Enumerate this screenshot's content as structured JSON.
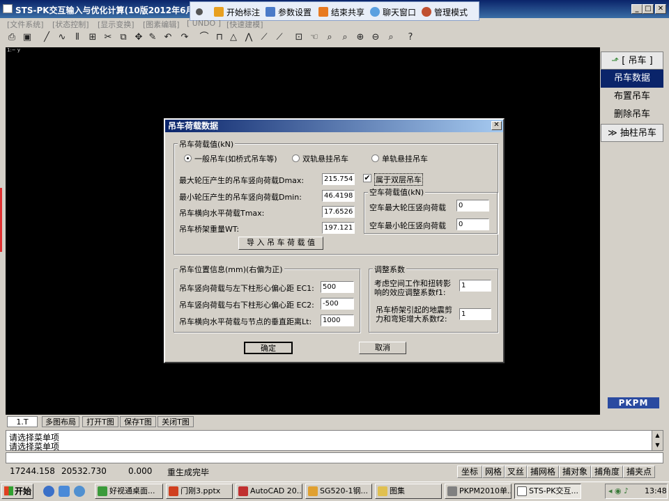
{
  "window": {
    "title": "STS-PK交互输入与优化计算(10版2012年6月30",
    "minimize": "_",
    "maximize": "□",
    "close": "✕"
  },
  "float_toolbar": {
    "items": [
      "开始标注",
      "参数设置",
      "结束共享",
      "聊天窗口",
      "管理模式"
    ]
  },
  "menu": {
    "items": [
      "[文件系统]",
      "[状态控制]",
      "[显示变换]",
      "[图素编辑]",
      "[ UNDO ]",
      "[快速建模]"
    ]
  },
  "canvas": {
    "coord_label": "1:− y"
  },
  "right_panel": {
    "header": "[ 吊车 ]",
    "items": [
      "吊车数据",
      "布置吊车",
      "删除吊车"
    ],
    "footer": "抽柱吊车",
    "logo": "PKPM"
  },
  "dialog": {
    "title": "吊车荷载数据",
    "close": "✕",
    "load_group": {
      "label": "吊车荷载值(kN)",
      "radios": [
        "一般吊车(如桥式吊车等)",
        "双轨悬挂吊车",
        "单轨悬挂吊车"
      ],
      "selected_radio": 0,
      "fields": [
        {
          "label": "最大轮压产生的吊车竖向荷载Dmax:",
          "value": "215.754"
        },
        {
          "label": "最小轮压产生的吊车竖向荷载Dmin:",
          "value": "46.4198"
        },
        {
          "label": "吊车横向水平荷载Tmax:",
          "value": "17.6526"
        },
        {
          "label": "吊车桥架重量WT:",
          "value": "197.121"
        }
      ],
      "double_checkbox_label": "属于双层吊车",
      "double_checked": true,
      "import_button": "导 入 吊 车 荷 载 值",
      "empty_group": {
        "label": "空车荷载值(kN)",
        "fields": [
          {
            "label": "空车最大轮压竖向荷载",
            "value": "0"
          },
          {
            "label": "空车最小轮压竖向荷载",
            "value": "0"
          }
        ]
      }
    },
    "position_group": {
      "label": "吊车位置信息(mm)(右偏为正)",
      "fields": [
        {
          "label": "吊车竖向荷载与左下柱形心偏心距 EC1:",
          "value": "500"
        },
        {
          "label": "吊车竖向荷载与右下柱形心偏心距 EC2:",
          "value": "-500"
        },
        {
          "label": "吊车横向水平荷载与节点的垂直距离Lt:",
          "value": "1000"
        }
      ]
    },
    "adjust_group": {
      "label": "调整系数",
      "fields": [
        {
          "label1": "考虑空间工作和扭转影",
          "label2": "响的效应调整系数f1:",
          "value": "1"
        },
        {
          "label1": "吊车桥架引起的地震剪",
          "label2": "力和弯矩增大系数f2:",
          "value": "1"
        }
      ]
    },
    "ok_button": "确定",
    "cancel_button": "取消"
  },
  "bottom_tabs": [
    "1.T",
    "多图布局",
    "打开T图",
    "保存T图",
    "关闭T图"
  ],
  "command_lines": [
    "请选择菜单项",
    "请选择菜单项"
  ],
  "status": {
    "x": "17244.158",
    "y": "20532.730",
    "z": "0.000",
    "message": "重生成完毕",
    "buttons": [
      "坐标",
      "网格",
      "叉丝",
      "捕网格",
      "捕对象",
      "捕角度",
      "捕夹点"
    ]
  },
  "taskbar": {
    "start": "开始",
    "tasks": [
      "好视通桌面...",
      "门刚3.pptx",
      "AutoCAD 20...",
      "SG520-1钢...",
      "图集",
      "PKPM2010单...",
      "STS-PK交互..."
    ],
    "active_task": 6,
    "clock": "13:48"
  },
  "colors": {
    "titlebar": "#0a246a",
    "panel_selected": "#0a246a",
    "canvas": "#000000"
  }
}
